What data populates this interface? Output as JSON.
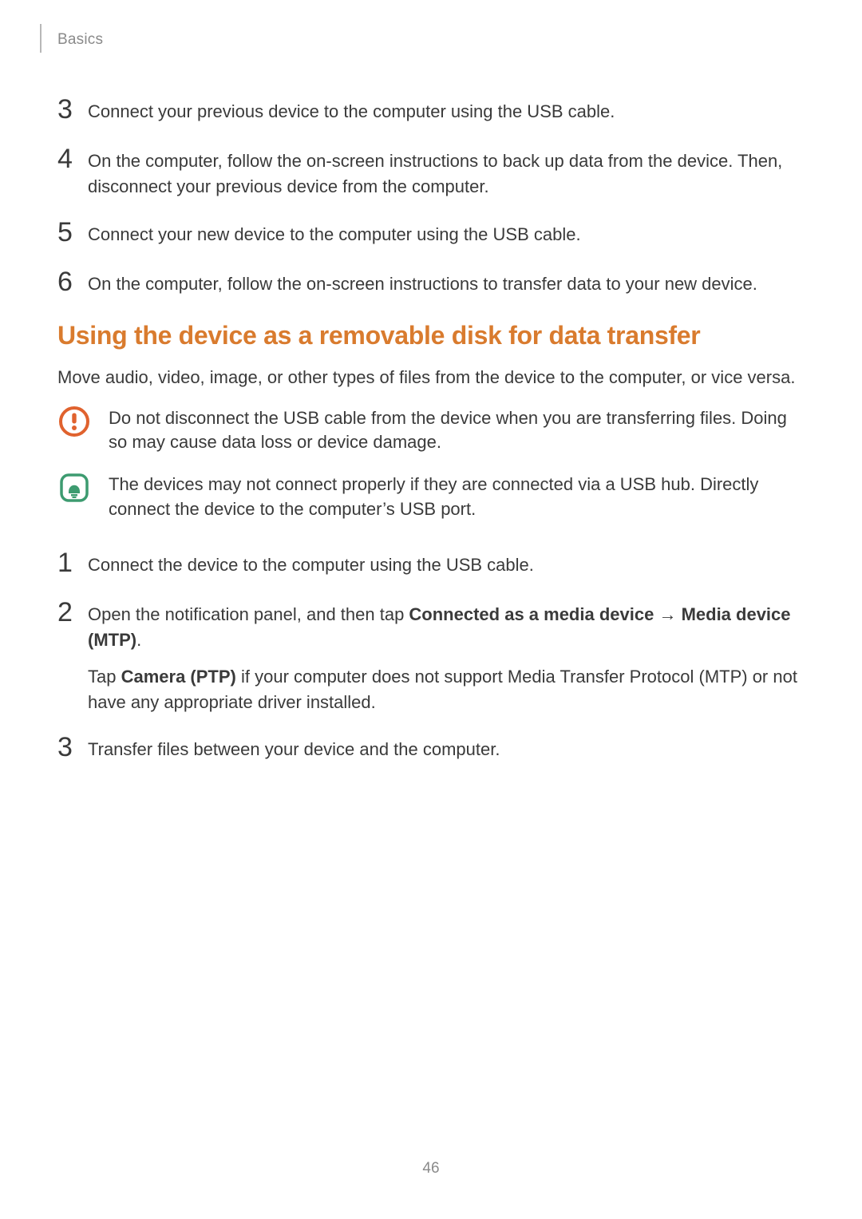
{
  "header": {
    "section": "Basics"
  },
  "steps_top": [
    {
      "num": "3",
      "text": "Connect your previous device to the computer using the USB cable."
    },
    {
      "num": "4",
      "text": "On the computer, follow the on-screen instructions to back up data from the device. Then, disconnect your previous device from the computer."
    },
    {
      "num": "5",
      "text": "Connect your new device to the computer using the USB cable."
    },
    {
      "num": "6",
      "text": "On the computer, follow the on-screen instructions to transfer data to your new device."
    }
  ],
  "heading": "Using the device as a removable disk for data transfer",
  "intro": "Move audio, video, image, or other types of files from the device to the computer, or vice versa.",
  "caution": "Do not disconnect the USB cable from the device when you are transferring files. Doing so may cause data loss or device damage.",
  "note": "The devices may not connect properly if they are connected via a USB hub. Directly connect the device to the computer’s USB port.",
  "steps_bottom": {
    "s1_num": "1",
    "s1_text": "Connect the device to the computer using the USB cable.",
    "s2_num": "2",
    "s2_pre": "Open the notification panel, and then tap ",
    "s2_bold1": "Connected as a media device",
    "s2_arrow": " → ",
    "s2_bold2": "Media device (MTP)",
    "s2_post": ".",
    "s2_extra_pre": "Tap ",
    "s2_extra_bold": "Camera (PTP)",
    "s2_extra_post": " if your computer does not support Media Transfer Protocol (MTP) or not have any appropriate driver installed.",
    "s3_num": "3",
    "s3_text": "Transfer files between your device and the computer."
  },
  "page_number": "46"
}
